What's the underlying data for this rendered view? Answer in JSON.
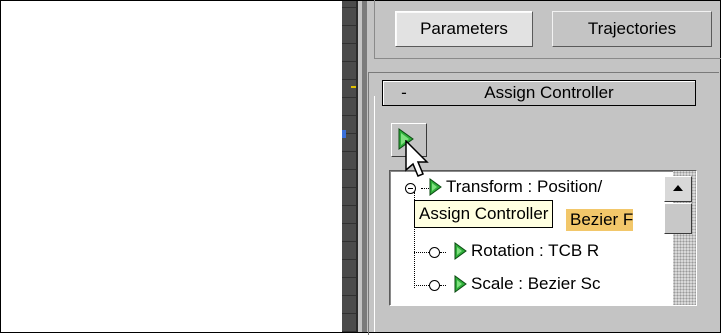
{
  "tabs": [
    {
      "label": "Parameters",
      "active": true
    },
    {
      "label": "Trajectories",
      "active": false
    }
  ],
  "rollout": {
    "toggle": "-",
    "title": "Assign Controller"
  },
  "toolbar": {
    "assign_button_icon": "assign-controller-icon"
  },
  "tree": {
    "items": [
      {
        "label": "Transform : Position/",
        "expanded": true
      },
      {
        "label": "Bezier F"
      },
      {
        "label": "Rotation : TCB R"
      },
      {
        "label": "Scale : Bezier Sc"
      }
    ]
  },
  "tooltip": {
    "text": "Assign Controller"
  },
  "colors": {
    "panel_bg": "#c4c4c4",
    "tooltip_bg": "#ffffe1",
    "selection_bg": "#f2c76a",
    "arrow_green": "#2fae3a"
  }
}
